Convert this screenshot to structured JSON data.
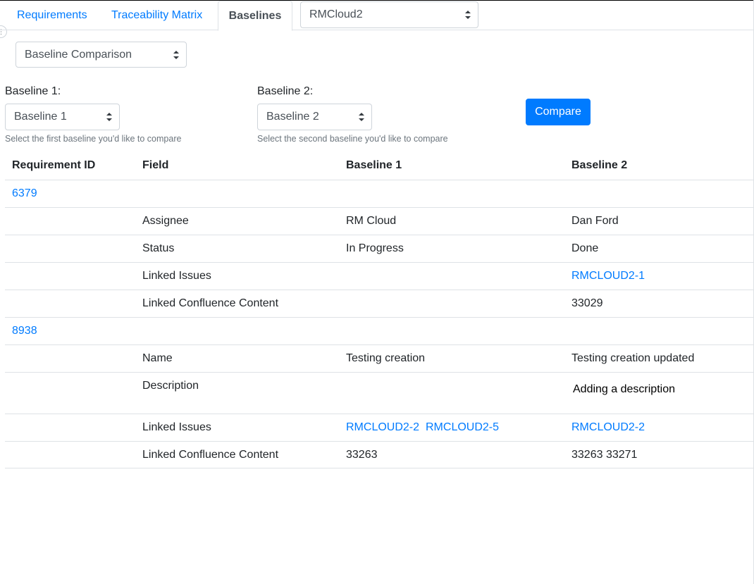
{
  "tabs": [
    {
      "label": "Requirements"
    },
    {
      "label": "Traceability Matrix"
    },
    {
      "label": "Baselines"
    }
  ],
  "project_select": {
    "value": "RMCloud2"
  },
  "view_select": {
    "value": "Baseline Comparison"
  },
  "baseline1": {
    "label": "Baseline 1:",
    "value": "Baseline 1",
    "help": "Select the first baseline you'd like to compare"
  },
  "baseline2": {
    "label": "Baseline 2:",
    "value": "Baseline 2",
    "help": "Select the second baseline you'd like to compare"
  },
  "compare_button": "Compare",
  "table": {
    "headers": [
      "Requirement ID",
      "Field",
      "Baseline 1",
      "Baseline 2"
    ],
    "groups": [
      {
        "id": "6379",
        "rows": [
          {
            "field": "Assignee",
            "b1": "RM Cloud",
            "b2": "Dan Ford"
          },
          {
            "field": "Status",
            "b1": "In Progress",
            "b2": "Done"
          },
          {
            "field": "Linked Issues",
            "b1": "",
            "b2_links": [
              "RMCLOUD2-1"
            ]
          },
          {
            "field": "Linked Confluence Content",
            "b1": "",
            "b2": "33029"
          }
        ]
      },
      {
        "id": "8938",
        "rows": [
          {
            "field": "Name",
            "b1": "Testing creation",
            "b2": "Testing creation updated"
          },
          {
            "field": "Description",
            "b1": "",
            "b2": "Adding a description"
          },
          {
            "field": "Linked Issues",
            "b1_links": [
              "RMCLOUD2-2",
              "RMCLOUD2-5"
            ],
            "b2_links": [
              "RMCLOUD2-2"
            ]
          },
          {
            "field": "Linked Confluence Content",
            "b1": "33263",
            "b2": "33263 33271"
          }
        ]
      }
    ]
  },
  "colors": {
    "link": "#007bff",
    "primary": "#007bff",
    "border": "#dee2e6"
  }
}
